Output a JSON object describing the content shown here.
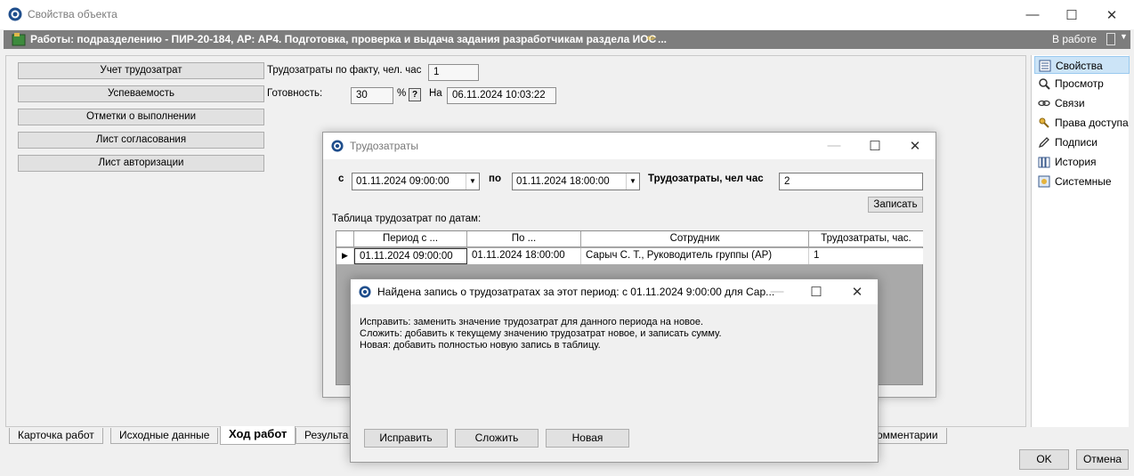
{
  "window": {
    "title": "Свойства объекта",
    "minimize": "—",
    "maximize": "☐",
    "close": "✕"
  },
  "header": {
    "title": "Работы: подразделению - ПИР-20-184, АР: АР4. Подготовка, проверка и выдача задания разработчикам раздела ИОС",
    "ellipsis": "...",
    "status": "В работе"
  },
  "left_buttons": [
    "Учет трудозатрат",
    "Успеваемость",
    "Отметки о выполнении",
    "Лист согласования",
    "Лист авторизации"
  ],
  "fields": {
    "fact_label": "Трудозатраты по факту, чел. час",
    "fact_value": "1",
    "ready_label": "Готовность:",
    "ready_value": "30",
    "ready_unit": "%",
    "help": "?",
    "at_label": "На",
    "at_value": "06.11.2024 10:03:22"
  },
  "right_panel": {
    "items": [
      {
        "label": "Свойства",
        "icon": "properties-icon"
      },
      {
        "label": "Просмотр",
        "icon": "magnifier-icon"
      },
      {
        "label": "Связи",
        "icon": "link-icon"
      },
      {
        "label": "Права доступа",
        "icon": "keys-icon"
      },
      {
        "label": "Подписи",
        "icon": "pen-icon"
      },
      {
        "label": "История",
        "icon": "history-icon"
      },
      {
        "label": "Системные",
        "icon": "system-icon"
      }
    ]
  },
  "tabs": [
    {
      "label": "Карточка работ"
    },
    {
      "label": "Исходные данные"
    },
    {
      "label": "Ход работ",
      "active": true
    },
    {
      "label": "Результа"
    },
    {
      "label": "омментарии"
    }
  ],
  "footer": {
    "ok": "OK",
    "cancel": "Отмена"
  },
  "labor_dialog": {
    "title": "Трудозатраты",
    "from_label": "с",
    "from_value": "01.11.2024 09:00:00",
    "to_label": "по",
    "to_value": "01.11.2024 18:00:00",
    "amount_label": "Трудозатраты, чел час",
    "amount_value": "2",
    "save_button": "Записать",
    "table_caption": "Таблица трудозатрат по датам:",
    "columns": [
      "Период с ...",
      "По ...",
      "Сотрудник",
      "Трудозатраты, час."
    ],
    "rows": [
      {
        "from": "01.11.2024 09:00:00",
        "to": "01.11.2024 18:00:00",
        "employee": "Сарыч С. Т., Руководитель группы (АР)",
        "hours": "1"
      }
    ],
    "row_marker": "▶"
  },
  "conflict_dialog": {
    "title": "Найдена запись о трудозатратах за этот период: с 01.11.2024 9:00:00 для Сар...",
    "lines": [
      "Исправить: заменить значение трудозатрат для данного периода на новое.",
      "Сложить: добавить к текущему значению трудозатрат новое, и записать сумму.",
      "Новая: добавить полностью новую запись в таблицу."
    ],
    "buttons": {
      "fix": "Исправить",
      "add": "Сложить",
      "new": "Новая"
    }
  },
  "colors": {
    "header_bg": "#7d7d7d",
    "selected_item_bg": "#cce4f7",
    "button_bg": "#e1e1e1",
    "grid_empty_bg": "#a9a9a9"
  }
}
